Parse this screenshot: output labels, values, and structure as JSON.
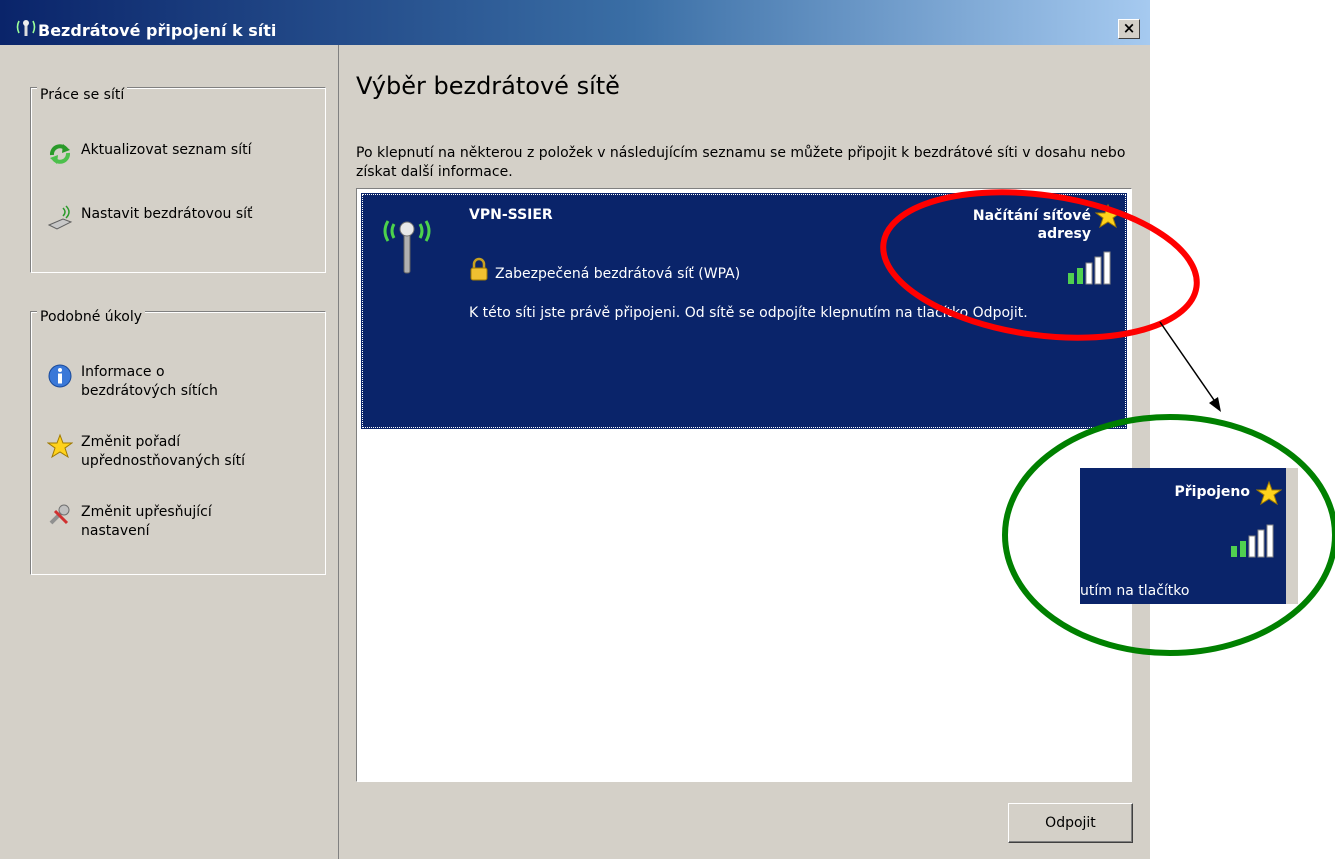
{
  "window": {
    "title": "Bezdrátové připojení k síti",
    "close_glyph": "×"
  },
  "sidebar": {
    "network_tasks": {
      "heading": "Práce se sítí",
      "items": [
        {
          "label": "Aktualizovat seznam sítí",
          "icon": "refresh-icon"
        },
        {
          "label": "Nastavit bezdrátovou síť",
          "icon": "wireless-setup-icon"
        }
      ]
    },
    "related_tasks": {
      "heading": "Podobné úkoly",
      "items": [
        {
          "label": "Informace o\nbezdrátových sítích",
          "icon": "info-icon"
        },
        {
          "label": "Změnit pořadí\nupřednostňovaných sítí",
          "icon": "star-icon"
        },
        {
          "label": "Změnit upřesňující\nnastavení",
          "icon": "settings-icon"
        }
      ]
    }
  },
  "main": {
    "title": "Výběr bezdrátové sítě",
    "description": "Po klepnutí na některou z položek v následujícím seznamu se můžete připojit k bezdrátové síti v dosahu nebo získat další informace.",
    "network": {
      "name": "VPN-SSIER",
      "status_line1": "Načítání síťové",
      "status_line2": "adresy",
      "security": "Zabezpečená bezdrátová síť (WPA)",
      "message": "K této síti jste právě připojeni. Od sítě se odpojíte klepnutím na tlačítko Odpojit.",
      "signal": "5 of 5 bars"
    },
    "disconnect_label": "Odpojit"
  },
  "callout": {
    "status": "Připojeno",
    "message_fragment": "utím na tlačítko"
  },
  "colors": {
    "selection": "#0a246a",
    "annotation_red": "#ff0000",
    "annotation_green": "#008000"
  }
}
